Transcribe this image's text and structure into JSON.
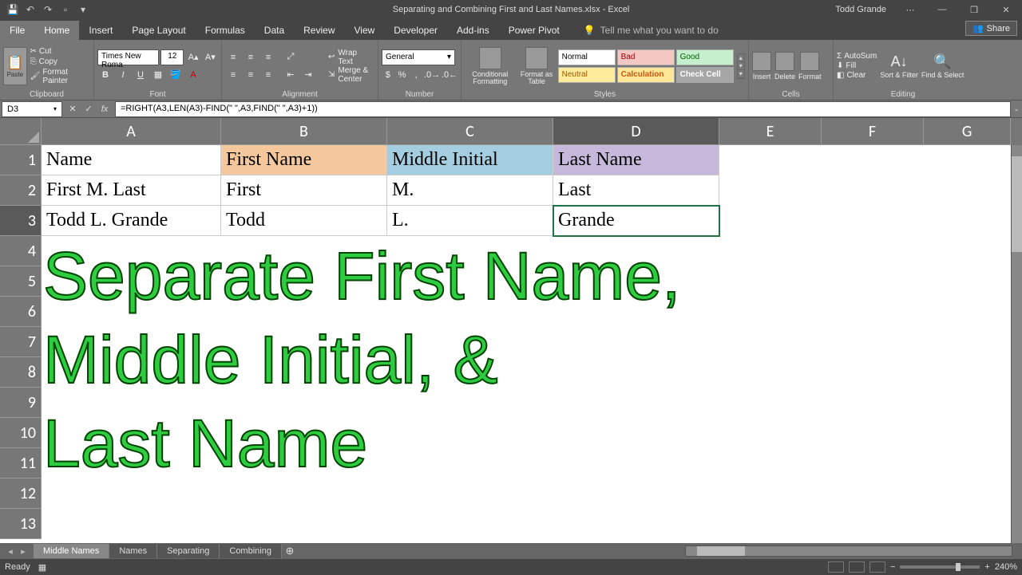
{
  "titlebar": {
    "title": "Separating and Combining First and Last Names.xlsx - Excel",
    "user": "Todd Grande"
  },
  "tabs": {
    "file": "File",
    "home": "Home",
    "insert": "Insert",
    "page_layout": "Page Layout",
    "formulas": "Formulas",
    "data": "Data",
    "review": "Review",
    "view": "View",
    "developer": "Developer",
    "addins": "Add-ins",
    "powerpivot": "Power Pivot",
    "tellme": "Tell me what you want to do",
    "share": "Share"
  },
  "ribbon": {
    "clipboard": {
      "label": "Clipboard",
      "paste": "Paste",
      "cut": "Cut",
      "copy": "Copy",
      "painter": "Format Painter"
    },
    "font": {
      "label": "Font",
      "name": "Times New Roma",
      "size": "12"
    },
    "alignment": {
      "label": "Alignment",
      "wrap": "Wrap Text",
      "merge": "Merge & Center"
    },
    "number": {
      "label": "Number",
      "format": "General"
    },
    "styles": {
      "label": "Styles",
      "cond": "Conditional Formatting",
      "table": "Format as Table",
      "normal": "Normal",
      "bad": "Bad",
      "good": "Good",
      "neutral": "Neutral",
      "calc": "Calculation",
      "check": "Check Cell"
    },
    "cells": {
      "label": "Cells",
      "insert": "Insert",
      "delete": "Delete",
      "format": "Format"
    },
    "editing": {
      "label": "Editing",
      "autosum": "AutoSum",
      "fill": "Fill",
      "clear": "Clear",
      "sort": "Sort & Filter",
      "find": "Find & Select"
    }
  },
  "formula_bar": {
    "name_box": "D3",
    "formula": "=RIGHT(A3,LEN(A3)-FIND(\" \",A3,FIND(\" \",A3)+1))"
  },
  "columns": [
    "A",
    "B",
    "C",
    "D",
    "E",
    "F",
    "G"
  ],
  "rows": [
    "1",
    "2",
    "3",
    "4",
    "5",
    "6",
    "7",
    "8",
    "9",
    "10",
    "11",
    "12",
    "13"
  ],
  "headers": {
    "A": "Name",
    "B": "First Name",
    "C": "Middle Initial",
    "D": "Last Name"
  },
  "data": {
    "r2": {
      "A": "First M. Last",
      "B": "First",
      "C": "M.",
      "D": "Last"
    },
    "r3": {
      "A": "Todd L. Grande",
      "B": "Todd",
      "C": "L.",
      "D": "Grande"
    }
  },
  "overlay": {
    "line1": "Separate First Name,",
    "line2": "Middle Initial, &",
    "line3": "Last Name"
  },
  "sheets": {
    "middle": "Middle Names",
    "names": "Names",
    "separating": "Separating",
    "combining": "Combining"
  },
  "status": {
    "ready": "Ready",
    "zoom": "240%"
  }
}
